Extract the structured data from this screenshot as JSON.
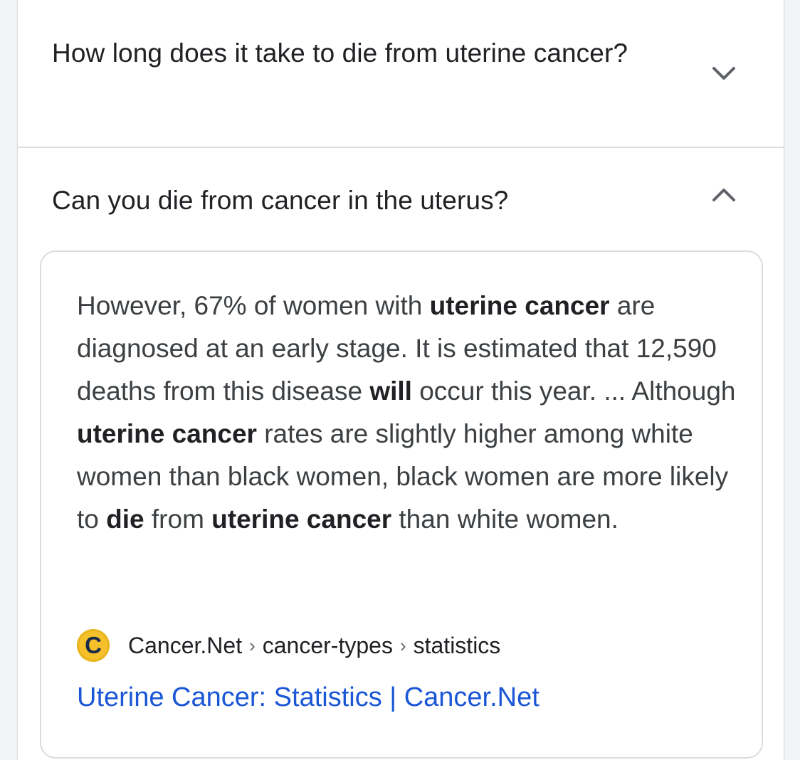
{
  "faq": {
    "items": [
      {
        "question": "How long does it take to die from uterine cancer?",
        "expanded": false,
        "chevron_icon": "chevron-down-icon"
      },
      {
        "question": "Can you die from cancer in the uterus?",
        "expanded": true,
        "chevron_icon": "chevron-up-icon"
      }
    ]
  },
  "answer": {
    "segments": [
      {
        "text": "However, 67% of women with ",
        "bold": false
      },
      {
        "text": "uterine cancer",
        "bold": true
      },
      {
        "text": " are diagnosed at an early stage. It is estimated that 12,590 deaths from this disease ",
        "bold": false
      },
      {
        "text": "will",
        "bold": true
      },
      {
        "text": " occur this year. ... Although ",
        "bold": false
      },
      {
        "text": "uterine cancer",
        "bold": true
      },
      {
        "text": " rates are slightly higher among white women than black women, black women are more likely to ",
        "bold": false
      },
      {
        "text": "die",
        "bold": true
      },
      {
        "text": " from ",
        "bold": false
      },
      {
        "text": "uterine cancer",
        "bold": true
      },
      {
        "text": " than white women.",
        "bold": false
      }
    ],
    "source": {
      "favicon_letter": "C",
      "favicon_color": "#f5c02a",
      "site": "Cancer.Net",
      "path1": "cancer-types",
      "path2": "statistics",
      "separator": "›"
    },
    "link_title": "Uterine Cancer: Statistics | Cancer.Net",
    "link_color": "#1a56d6"
  }
}
